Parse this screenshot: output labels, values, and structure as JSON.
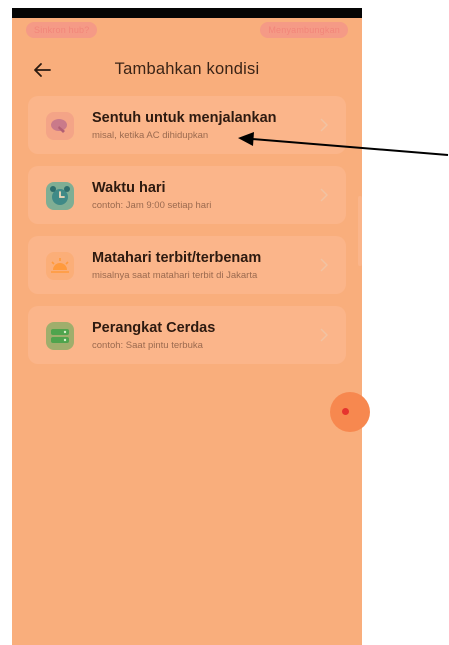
{
  "status_bar": {
    "left_pill": "Sinkron hub?",
    "right_pill": "Menyambungkan"
  },
  "header": {
    "title": "Tambahkan kondisi"
  },
  "conditions": [
    {
      "title": "Sentuh untuk menjalankan",
      "subtitle": "misal, ketika AC dihidupkan",
      "icon": "touch-icon"
    },
    {
      "title": "Waktu hari",
      "subtitle": "contoh: Jam 9:00 setiap hari",
      "icon": "alarm-clock-icon"
    },
    {
      "title": "Matahari terbit/terbenam",
      "subtitle": "misalnya saat matahari terbit di Jakarta",
      "icon": "sunrise-icon"
    },
    {
      "title": "Perangkat Cerdas",
      "subtitle": "contoh: Saat pintu terbuka",
      "icon": "smart-device-icon"
    }
  ],
  "colors": {
    "overlay": "#f9ae7c",
    "card": "#fbb58a",
    "touch_icon": "#c97a8a",
    "clock_icon": "#3f8a87",
    "sun_icon": "#ff9a3c",
    "device_icon": "#4fa44d"
  }
}
